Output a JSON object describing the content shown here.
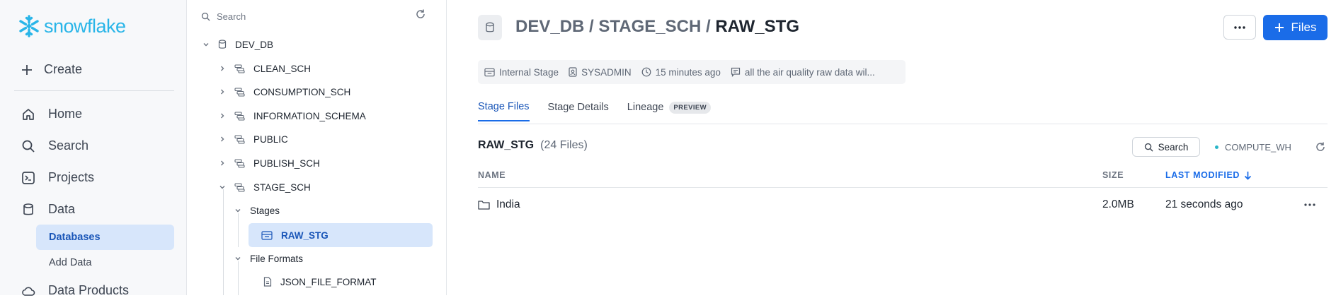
{
  "brand": {
    "name": "snowflake",
    "color": "#29b5e8"
  },
  "nav": {
    "create_label": "Create",
    "items": [
      {
        "label": "Home",
        "icon": "home-icon"
      },
      {
        "label": "Search",
        "icon": "search-icon"
      },
      {
        "label": "Projects",
        "icon": "projects-icon"
      },
      {
        "label": "Data",
        "icon": "database-icon"
      }
    ],
    "sub_items": [
      {
        "label": "Databases",
        "active": true
      },
      {
        "label": "Add Data",
        "active": false
      }
    ],
    "partial_item": {
      "label": "Data Products",
      "icon": "cloud-icon"
    }
  },
  "tree": {
    "search_placeholder": "Search",
    "database": "DEV_DB",
    "schemas": [
      "CLEAN_SCH",
      "CONSUMPTION_SCH",
      "INFORMATION_SCHEMA",
      "PUBLIC",
      "PUBLISH_SCH",
      "STAGE_SCH"
    ],
    "stages_label": "Stages",
    "stage_selected": "RAW_STG",
    "file_formats_label": "File Formats",
    "file_format": "JSON_FILE_FORMAT"
  },
  "main": {
    "breadcrumb": {
      "db": "DEV_DB",
      "schema": "STAGE_SCH",
      "object": "RAW_STG",
      "separator": "/"
    },
    "more_label": "•••",
    "files_button": "Files",
    "meta": {
      "type": "Internal Stage",
      "owner": "SYSADMIN",
      "time": "15 minutes ago",
      "comment": "all the air quality raw data wil..."
    },
    "tabs": [
      {
        "label": "Stage Files",
        "active": true
      },
      {
        "label": "Stage Details",
        "active": false
      },
      {
        "label": "Lineage",
        "active": false,
        "badge": "PREVIEW"
      }
    ],
    "list": {
      "name": "RAW_STG",
      "count": "(24 Files)",
      "search_label": "Search",
      "warehouse": "COMPUTE_WH",
      "columns": {
        "name": "NAME",
        "size": "SIZE",
        "modified": "LAST MODIFIED"
      },
      "rows": [
        {
          "name": "India",
          "size": "2.0MB",
          "modified": "21 seconds ago",
          "icon": "folder-icon"
        }
      ]
    }
  },
  "colors": {
    "accent": "#1a6ce8",
    "active_bg": "#d7e6fb",
    "warehouse_dot": "#29b5c8"
  }
}
